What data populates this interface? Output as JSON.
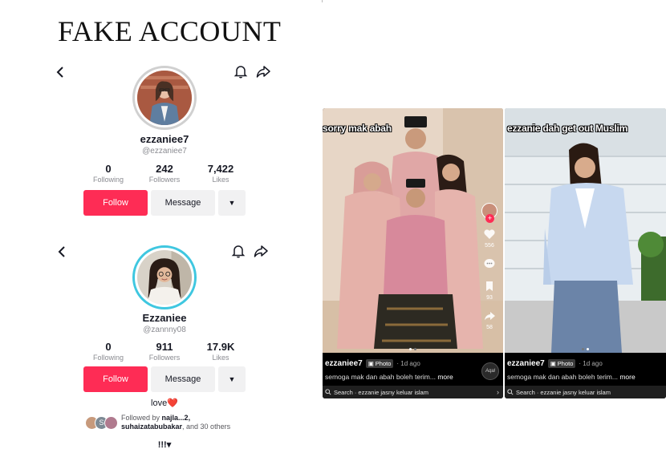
{
  "headline": "FAKE ACCOUNT",
  "profile_fake": {
    "display_name": "ezzaniee7",
    "handle": "@ezzaniee7",
    "stats": [
      {
        "value": "0",
        "label": "Following"
      },
      {
        "value": "242",
        "label": "Followers"
      },
      {
        "value": "7,422",
        "label": "Likes"
      }
    ],
    "follow_label": "Follow",
    "message_label": "Message",
    "more_glyph": "▼"
  },
  "profile_real": {
    "display_name": "Ezzaniee",
    "handle": "@zannny08",
    "stats": [
      {
        "value": "0",
        "label": "Following"
      },
      {
        "value": "911",
        "label": "Followers"
      },
      {
        "value": "17.9K",
        "label": "Likes"
      }
    ],
    "follow_label": "Follow",
    "message_label": "Message",
    "more_glyph": "▼",
    "bio": "love❤️",
    "followed_by_prefix": "Followed by",
    "followed_by_names": "najla...2,",
    "followed_by_line2_name": "suhaizatabubakar",
    "followed_by_suffix": ", and 30 others",
    "mini_avatar_letter": "S",
    "more_row": "!!!▾"
  },
  "post_a": {
    "overlay_title": "sorry mak abah",
    "username": "ezzaniee7",
    "badge": "Photo",
    "time": "· 1d ago",
    "caption": "semoga mak dan abah boleh terim...",
    "more": "more",
    "search_text": "Search · ezzanie jasny keluar islam",
    "side_counts": [
      "556",
      "93",
      "58"
    ],
    "music_text": "Aqal"
  },
  "post_b": {
    "overlay_title": "ezzanie dah get out Muslim",
    "username": "ezzaniee7",
    "badge": "Photo",
    "time": "· 1d ago",
    "caption": "semoga mak dan abah boleh terim...",
    "more": "more",
    "search_text": "Search · ezzanie jasny keluar islam"
  },
  "colors": {
    "follow_red": "#fe2c55",
    "real_ring": "#3fc7e0",
    "fake_ring": "#d0d0d0"
  },
  "icons": [
    "back-icon",
    "bell-icon",
    "share-icon",
    "heart-icon",
    "comment-icon",
    "bookmark-icon",
    "search-icon"
  ]
}
